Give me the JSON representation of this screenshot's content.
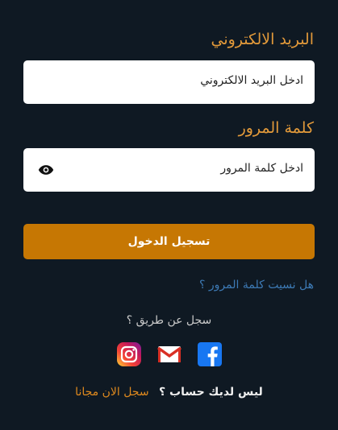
{
  "form": {
    "email_label": "البريد الالكتروني",
    "email_placeholder": "ادخل البريد الالكتروني",
    "password_label": "كلمة المرور",
    "password_placeholder": "ادخل كلمة المرور",
    "login_button": "تسجيل الدخول",
    "forgot_password": "هل نسيت كلمة المرور ؟"
  },
  "social": {
    "heading": "سجل عن طريق ؟",
    "providers": [
      "facebook",
      "gmail",
      "instagram"
    ],
    "icons": [
      "facebook-icon",
      "gmail-icon",
      "instagram-icon"
    ]
  },
  "signup": {
    "prompt": "ليس لديك حساب ؟",
    "link": "سجل الان مجانا"
  },
  "colors": {
    "background": "#0f1923",
    "label": "#e39a3a",
    "button": "#c67703",
    "forgot_link": "#3d7ab5",
    "signup_link": "#e08a1e",
    "facebook": "#1877f2",
    "gmail_red": "#d93025"
  }
}
